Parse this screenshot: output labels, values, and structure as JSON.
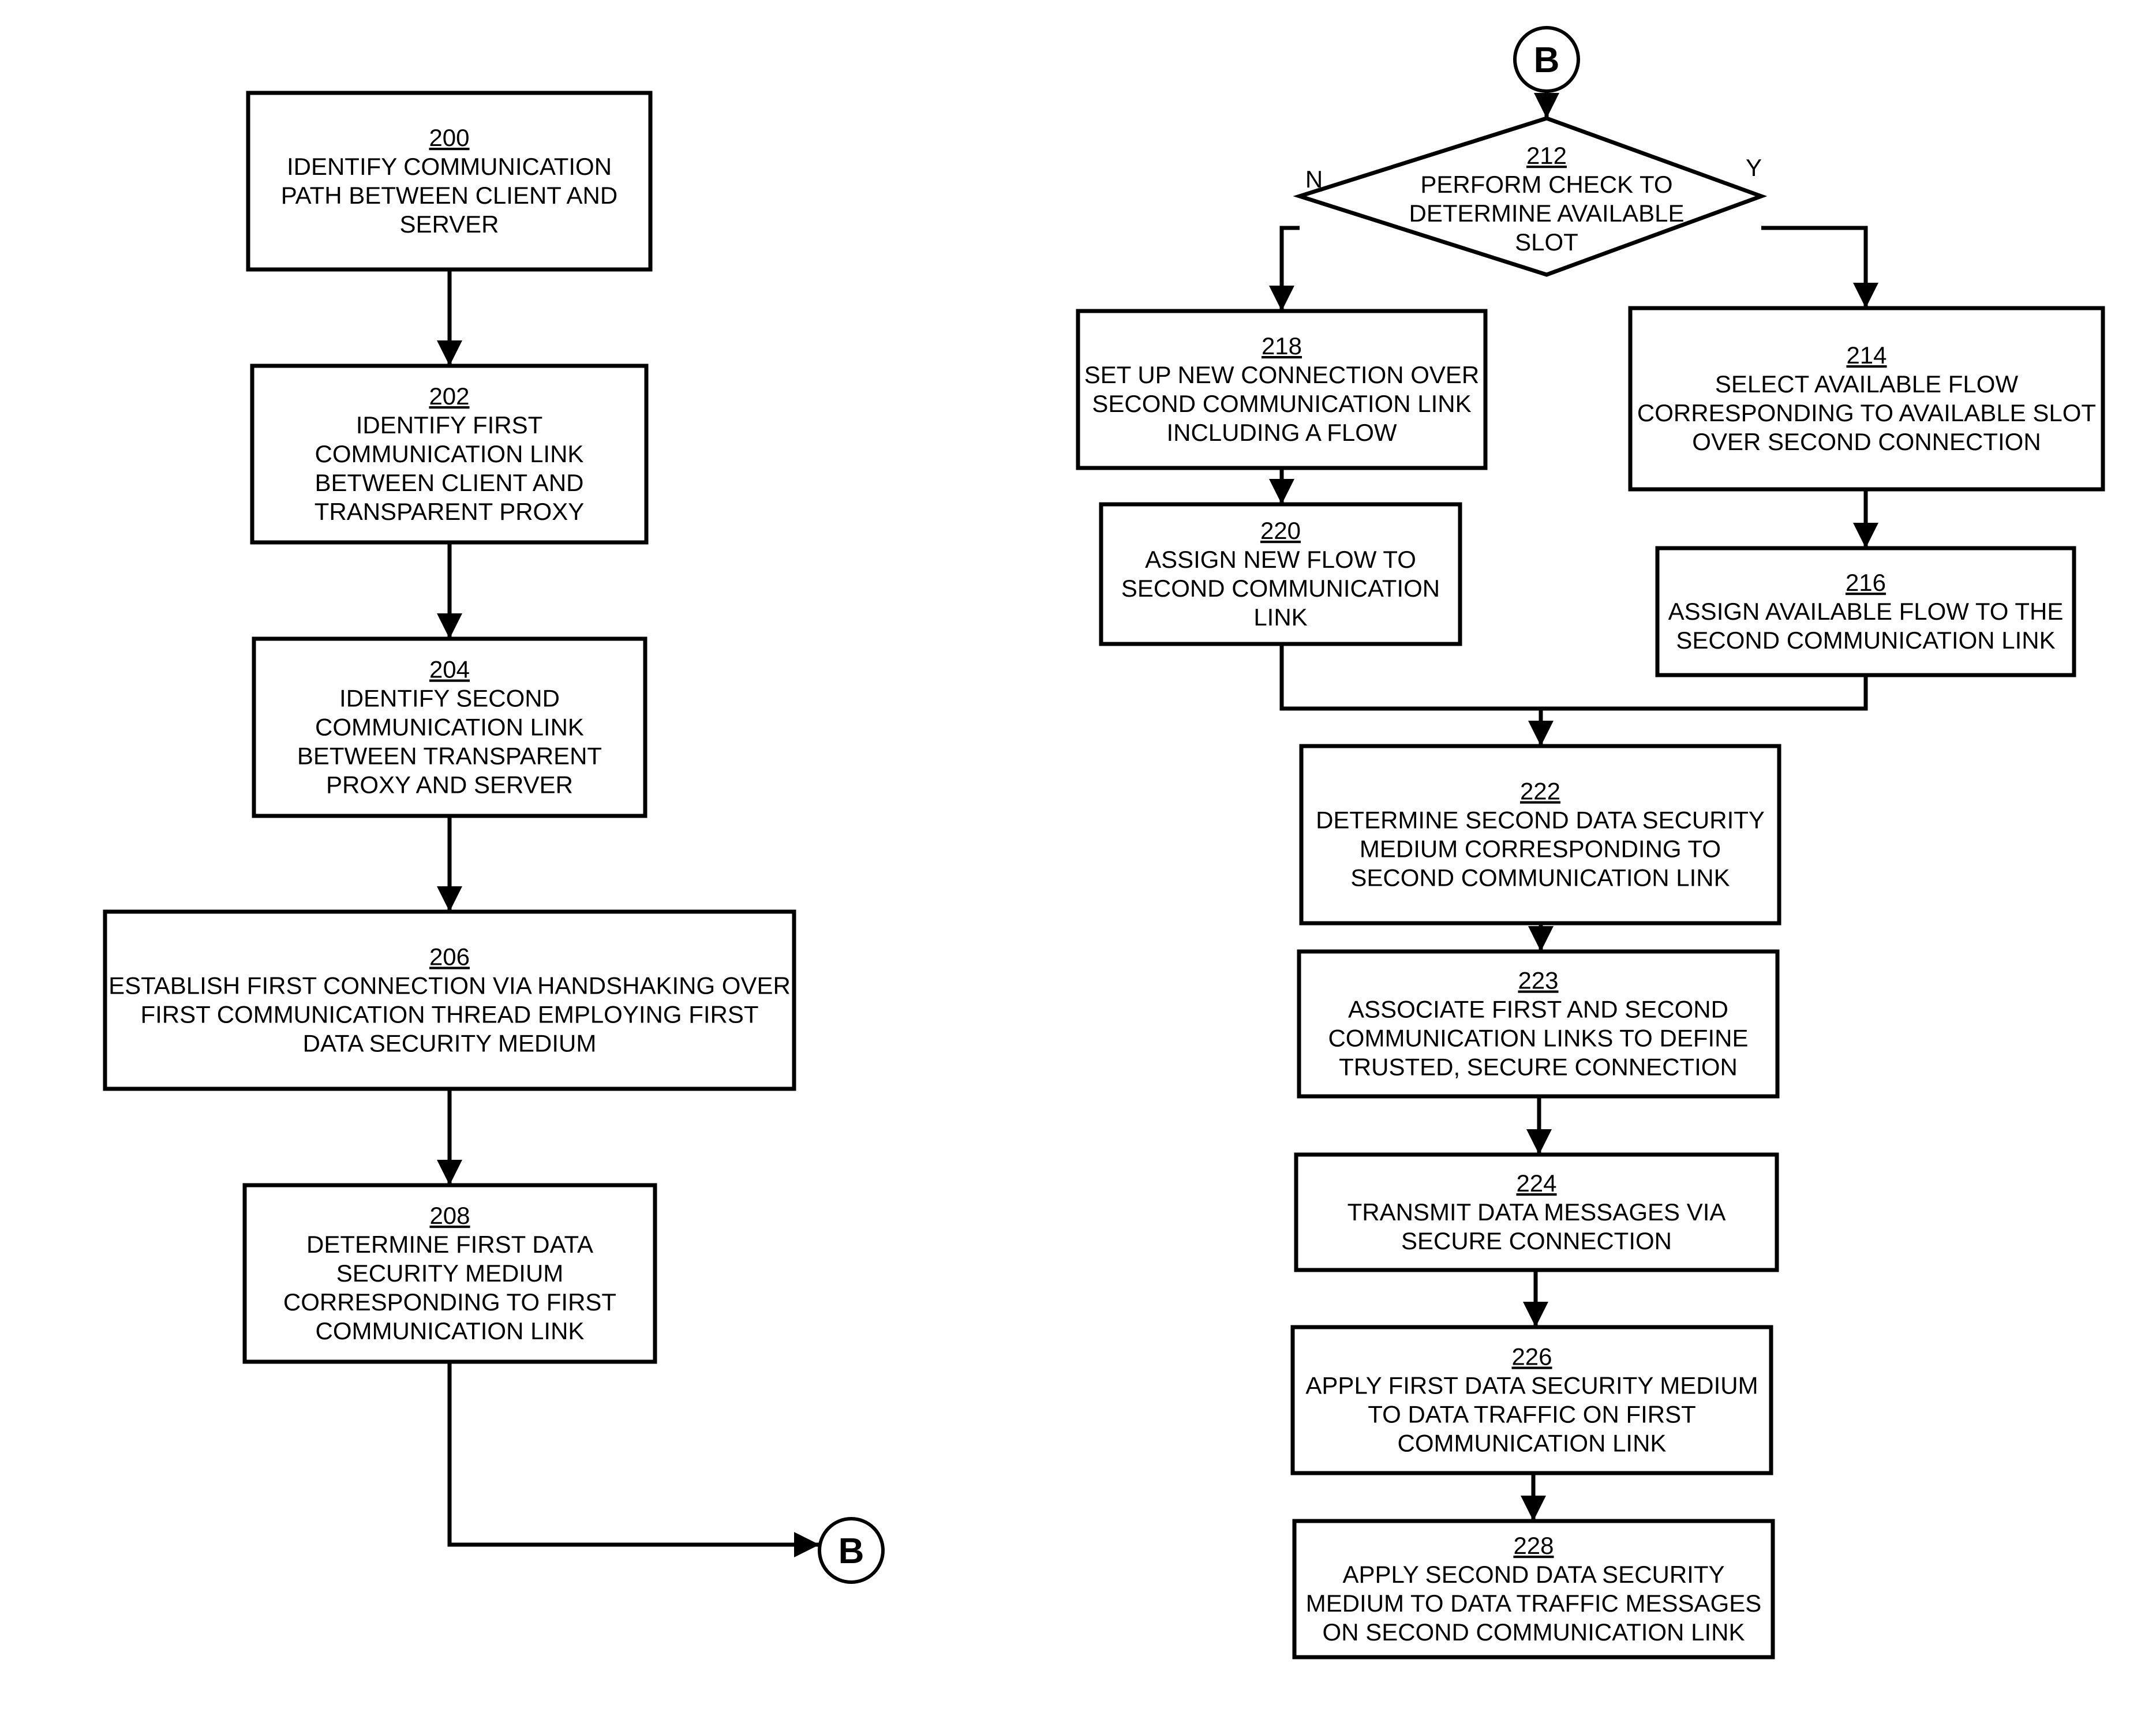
{
  "figure": {
    "left_column": {
      "steps": [
        {
          "id": "200",
          "lines": [
            "IDENTIFY COMMUNICATION",
            "PATH BETWEEN CLIENT AND",
            "SERVER"
          ]
        },
        {
          "id": "202",
          "lines": [
            "IDENTIFY FIRST",
            "COMMUNICATION LINK",
            "BETWEEN CLIENT AND",
            "TRANSPARENT PROXY"
          ]
        },
        {
          "id": "204",
          "lines": [
            "IDENTIFY SECOND",
            "COMMUNICATION LINK",
            "BETWEEN TRANSPARENT",
            "PROXY AND SERVER"
          ]
        },
        {
          "id": "206",
          "lines": [
            "ESTABLISH FIRST CONNECTION VIA HANDSHAKING OVER",
            "FIRST COMMUNICATION THREAD EMPLOYING FIRST",
            "DATA SECURITY MEDIUM"
          ]
        },
        {
          "id": "208",
          "lines": [
            "DETERMINE FIRST DATA",
            "SECURITY MEDIUM",
            "CORRESPONDING TO FIRST",
            "COMMUNICATION LINK"
          ]
        }
      ],
      "connector_out": "B"
    },
    "right_column": {
      "connector_in": "B",
      "decision": {
        "id": "212",
        "lines": [
          "PERFORM CHECK TO",
          "DETERMINE AVAILABLE",
          "SLOT"
        ],
        "no_label": "N",
        "yes_label": "Y"
      },
      "no_branch": [
        {
          "id": "218",
          "lines": [
            "SET UP NEW CONNECTION OVER",
            "SECOND COMMUNICATION LINK",
            "INCLUDING A FLOW"
          ]
        },
        {
          "id": "220",
          "lines": [
            "ASSIGN NEW FLOW TO",
            "SECOND COMMUNICATION",
            "LINK"
          ]
        }
      ],
      "yes_branch": [
        {
          "id": "214",
          "lines": [
            "SELECT AVAILABLE FLOW",
            "CORRESPONDING TO AVAILABLE SLOT",
            "OVER SECOND CONNECTION"
          ]
        },
        {
          "id": "216",
          "lines": [
            "ASSIGN AVAILABLE FLOW TO THE",
            "SECOND COMMUNICATION LINK"
          ]
        }
      ],
      "steps": [
        {
          "id": "222",
          "lines": [
            "DETERMINE SECOND DATA SECURITY",
            "MEDIUM CORRESPONDING TO",
            "SECOND COMMUNICATION LINK"
          ]
        },
        {
          "id": "223",
          "lines": [
            "ASSOCIATE FIRST AND SECOND",
            "COMMUNICATION LINKS TO DEFINE",
            "TRUSTED, SECURE  CONNECTION"
          ]
        },
        {
          "id": "224",
          "lines": [
            "TRANSMIT DATA MESSAGES VIA",
            "SECURE CONNECTION"
          ]
        },
        {
          "id": "226",
          "lines": [
            "APPLY FIRST DATA SECURITY MEDIUM",
            "TO DATA TRAFFIC ON FIRST",
            "COMMUNICATION LINK"
          ]
        },
        {
          "id": "228",
          "lines": [
            "APPLY SECOND DATA SECURITY",
            "MEDIUM TO DATA TRAFFIC MESSAGES",
            "ON SECOND COMMUNICATION LINK"
          ]
        }
      ]
    }
  }
}
